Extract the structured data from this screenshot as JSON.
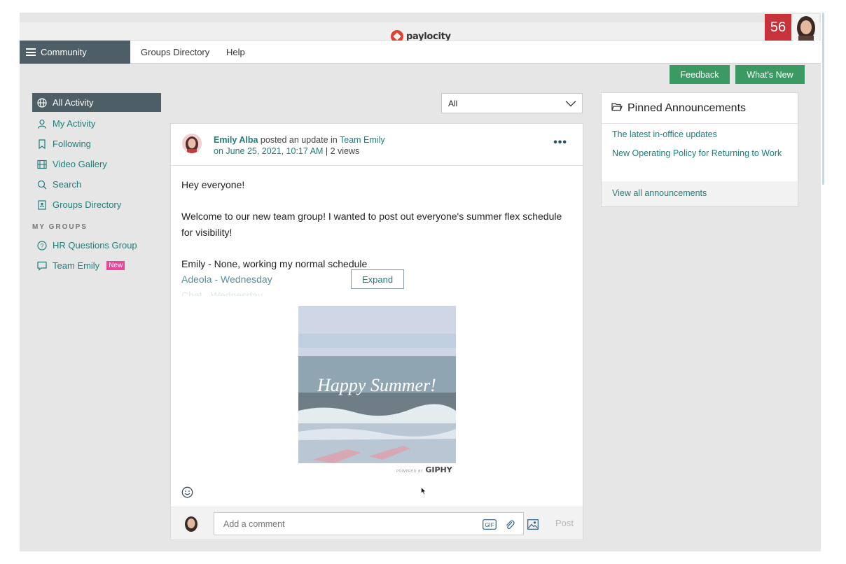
{
  "header": {
    "logo_text": "paylocity",
    "notification_count": "56",
    "accent_red": "#c8323a",
    "brand_red": "#e2402f"
  },
  "nav": {
    "community_label": "Community",
    "links": [
      "Groups Directory",
      "Help"
    ],
    "nav_bg": "#4e5e66"
  },
  "actions": {
    "feedback_label": "Feedback",
    "whats_new_label": "What's New",
    "button_color": "#3b9a62"
  },
  "sidebar": {
    "items": [
      {
        "label": "All Activity",
        "icon": "globe-icon",
        "active": true
      },
      {
        "label": "My Activity",
        "icon": "user-icon"
      },
      {
        "label": "Following",
        "icon": "bookmark-icon"
      },
      {
        "label": "Video Gallery",
        "icon": "film-icon"
      },
      {
        "label": "Search",
        "icon": "search-icon"
      },
      {
        "label": "Groups Directory",
        "icon": "directory-icon"
      }
    ],
    "section_title": "MY GROUPS",
    "groups": [
      {
        "label": "HR Questions Group",
        "icon": "question-circle-icon"
      },
      {
        "label": "Team Emily",
        "icon": "chat-icon",
        "badge": "New"
      }
    ]
  },
  "filter": {
    "selected": "All"
  },
  "post": {
    "author": "Emily Alba",
    "action_text": " posted an update in ",
    "group": "Team Emily",
    "date": "on June 25, 2021, 10:17 AM",
    "separator": " | ",
    "views": "2 views",
    "greeting": "Hey everyone!",
    "paragraph": "Welcome to our new team group! I wanted to post out everyone's summer flex schedule for visibility!",
    "schedule": [
      "Emily - None, working my normal schedule",
      "Adeola - Wednesday",
      "Chet - Wednesday"
    ],
    "expand_label": "Expand",
    "gif_caption": "Happy Summer!",
    "giphy_powered": "POWERED BY",
    "giphy_label": "GIPHY",
    "link_color": "#217c7a"
  },
  "comment": {
    "placeholder": "Add a comment",
    "gif_label": "GIF",
    "post_label": "Post"
  },
  "pinned": {
    "title": "Pinned Announcements",
    "items": [
      "The latest in-office updates",
      "New Operating Policy for Returning to Work"
    ],
    "footer": "View all announcements"
  }
}
